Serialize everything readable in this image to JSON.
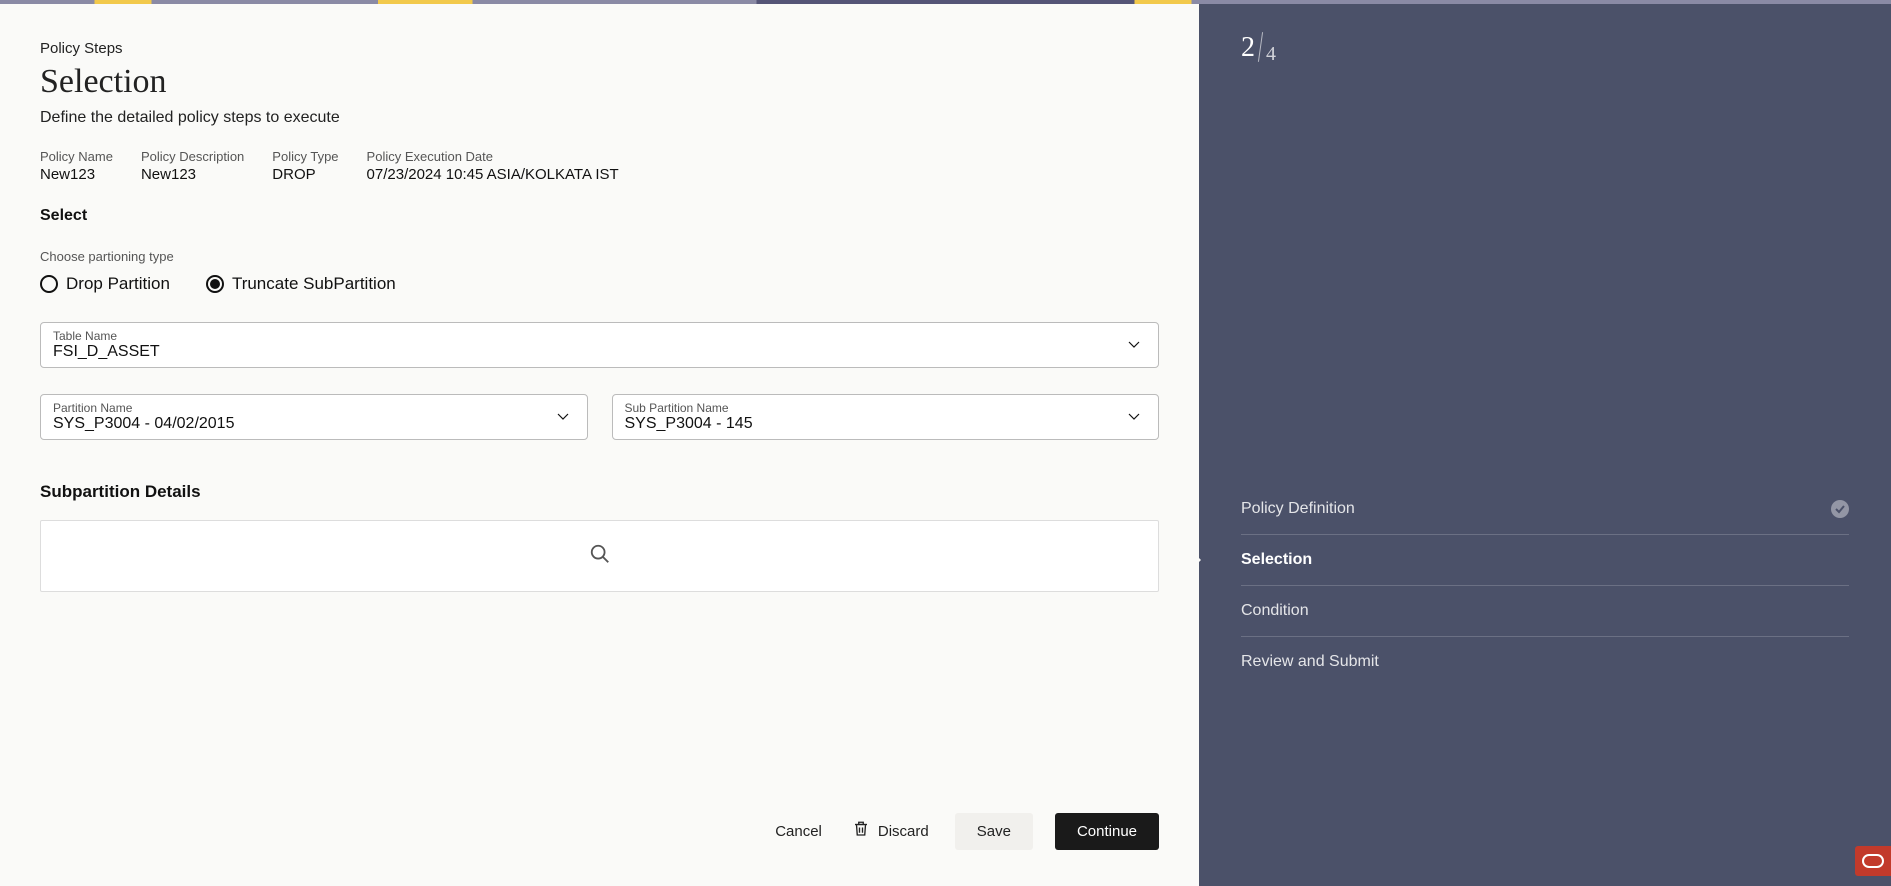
{
  "breadcrumb": "Policy Steps",
  "page_title": "Selection",
  "page_subtitle": "Define the detailed policy steps to execute",
  "meta": {
    "policy_name_label": "Policy Name",
    "policy_name_value": "New123",
    "policy_desc_label": "Policy Description",
    "policy_desc_value": "New123",
    "policy_type_label": "Policy Type",
    "policy_type_value": "DROP",
    "policy_exec_label": "Policy Execution Date",
    "policy_exec_value": "07/23/2024 10:45 ASIA/KOLKATA IST"
  },
  "select_section_label": "Select",
  "partition_prompt": "Choose partioning type",
  "radios": {
    "drop_label": "Drop Partition",
    "truncate_label": "Truncate SubPartition",
    "selected": "truncate"
  },
  "table_select": {
    "label": "Table Name",
    "value": "FSI_D_ASSET"
  },
  "partition_select": {
    "label": "Partition Name",
    "value": "SYS_P3004  -  04/02/2015"
  },
  "subpartition_select": {
    "label": "Sub Partition Name",
    "value": "SYS_P3004  -  145"
  },
  "subpartition_details_title": "Subpartition Details",
  "actions": {
    "cancel": "Cancel",
    "discard": "Discard",
    "save": "Save",
    "continue": "Continue"
  },
  "sidebar": {
    "current_step": "2",
    "total_steps": "4",
    "steps": [
      {
        "label": "Policy Definition",
        "done": true,
        "active": false
      },
      {
        "label": "Selection",
        "done": false,
        "active": true
      },
      {
        "label": "Condition",
        "done": false,
        "active": false
      },
      {
        "label": "Review and Submit",
        "done": false,
        "active": false
      }
    ]
  }
}
